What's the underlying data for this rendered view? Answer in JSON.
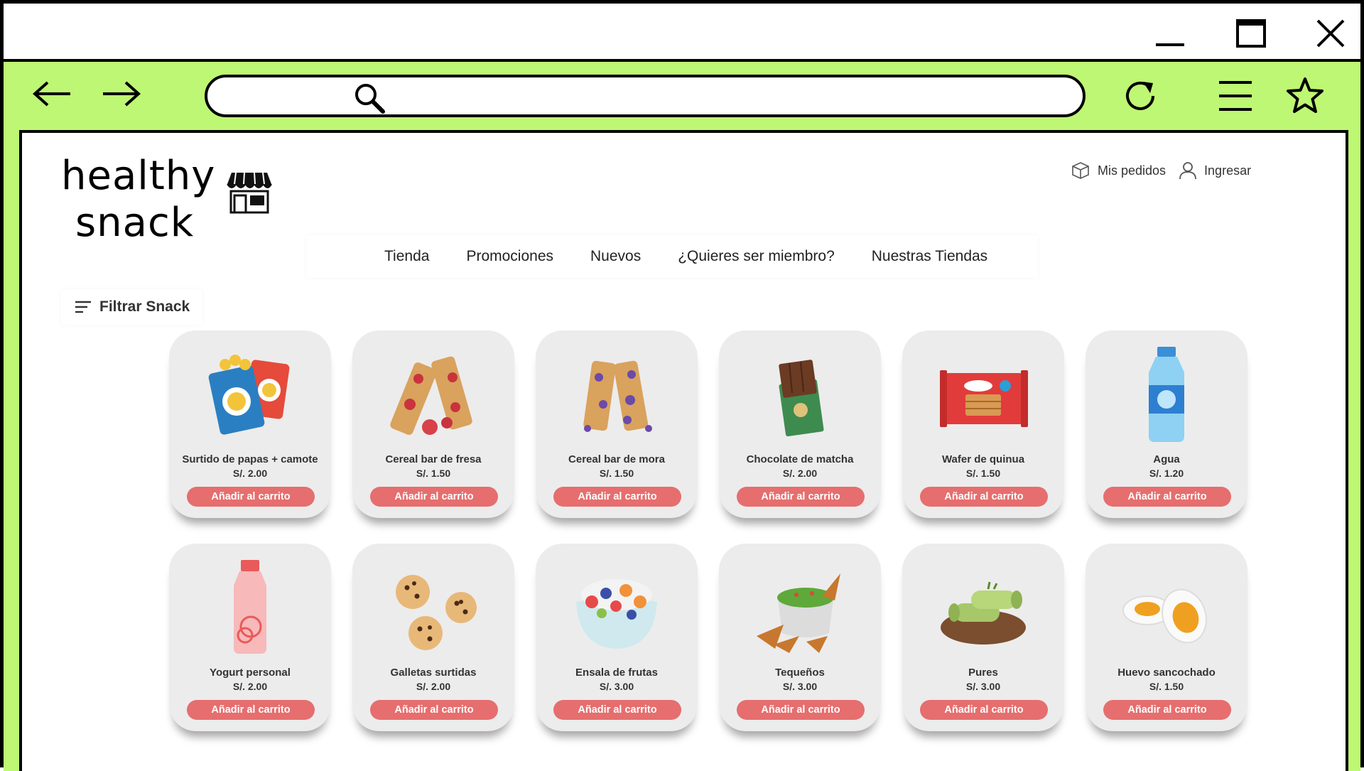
{
  "browser": {
    "search": {
      "value": "",
      "placeholder": ""
    },
    "icons": [
      "minimize-icon",
      "maximize-icon",
      "close-icon",
      "back-arrow-icon",
      "forward-arrow-icon",
      "search-icon",
      "reload-icon",
      "menu-icon",
      "star-icon"
    ]
  },
  "site": {
    "logo": {
      "line1": "healthy",
      "line2": "snack"
    },
    "header": {
      "orders_label": "Mis pedidos",
      "login_label": "Ingresar"
    },
    "nav": [
      "Tienda",
      "Promociones",
      "Nuevos",
      "¿Quieres ser miembro?",
      "Nuestras Tiendas"
    ],
    "filter_label": "Filtrar Snack",
    "button_label": "Añadir al carrito",
    "colors": {
      "frame": "#bef773",
      "card": "#ececec",
      "button": "#e66e6e"
    },
    "products": [
      {
        "name": "Surtido de papas + camote",
        "price": "S/. 2.00",
        "icon": "chips-icon"
      },
      {
        "name": "Cereal bar de fresa",
        "price": "S/. 1.50",
        "icon": "strawberry-bar-icon"
      },
      {
        "name": "Cereal bar de mora",
        "price": "S/. 1.50",
        "icon": "blackberry-bar-icon"
      },
      {
        "name": "Chocolate de matcha",
        "price": "S/. 2.00",
        "icon": "chocolate-icon"
      },
      {
        "name": "Wafer de quinua",
        "price": "S/. 1.50",
        "icon": "wafer-icon"
      },
      {
        "name": "Agua",
        "price": "S/. 1.20",
        "icon": "water-bottle-icon"
      },
      {
        "name": "Yogurt personal",
        "price": "S/. 2.00",
        "icon": "yogurt-icon"
      },
      {
        "name": "Galletas surtidas",
        "price": "S/. 2.00",
        "icon": "cookies-icon"
      },
      {
        "name": "Ensala de frutas",
        "price": "S/. 3.00",
        "icon": "fruit-salad-icon"
      },
      {
        "name": "Tequeños",
        "price": "S/. 3.00",
        "icon": "nachos-icon"
      },
      {
        "name": "Pures",
        "price": "S/. 3.00",
        "icon": "rolls-icon"
      },
      {
        "name": "Huevo sancochado",
        "price": "S/. 1.50",
        "icon": "boiled-egg-icon"
      }
    ]
  }
}
